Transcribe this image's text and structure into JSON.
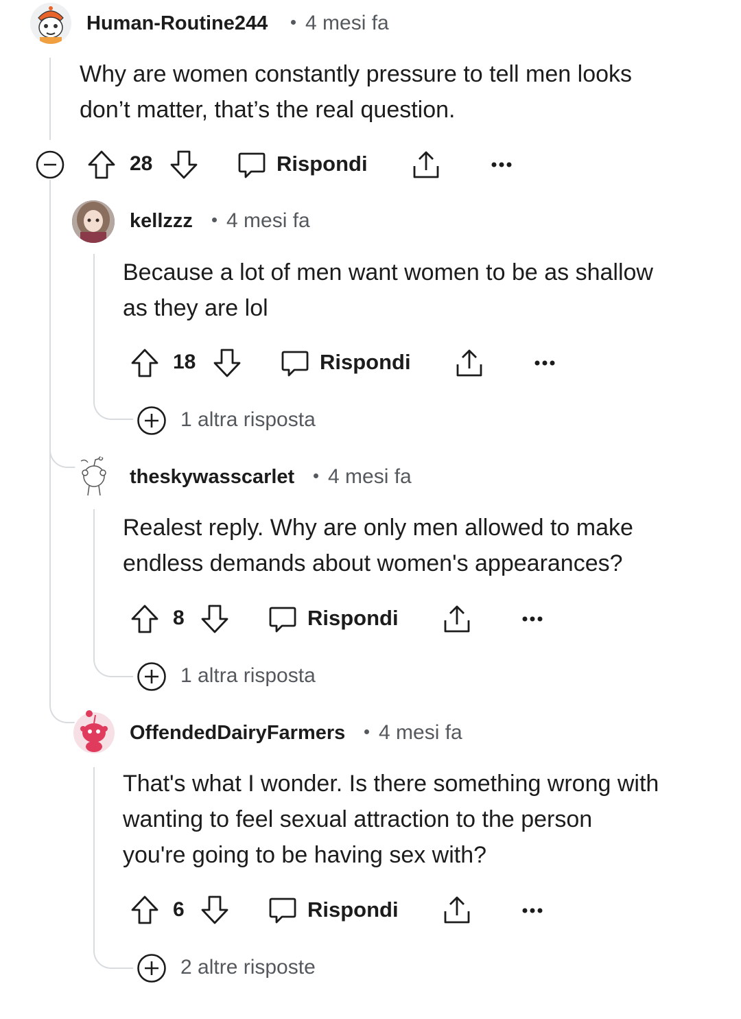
{
  "comments": [
    {
      "username": "Human-Routine244",
      "time": "4 mesi fa",
      "body": [
        "Why are women constantly pressure to tell men looks",
        "don’t matter, that’s the real question."
      ],
      "votes": "28",
      "reply_label": "Rispondi"
    },
    {
      "username": "kellzzz",
      "time": "4 mesi fa",
      "body": [
        "Because a lot of men want women to be as shallow",
        "as they are lol"
      ],
      "votes": "18",
      "reply_label": "Rispondi",
      "more_replies": "1 altra risposta"
    },
    {
      "username": "theskywasscarlet",
      "time": "4 mesi fa",
      "body": [
        "Realest reply. Why are only men allowed to make",
        "endless demands about women's appearances?"
      ],
      "votes": "8",
      "reply_label": "Rispondi",
      "more_replies": "1 altra risposta"
    },
    {
      "username": "OffendedDairyFarmers",
      "time": "4 mesi fa",
      "body": [
        "That's what I wonder. Is there something wrong with",
        "wanting to feel sexual attraction to the person",
        "you're going to be having sex with?"
      ],
      "votes": "6",
      "reply_label": "Rispondi",
      "more_replies": "2 altre risposte"
    }
  ],
  "colors": {
    "text": "#1c1c1c",
    "meta": "#55595d",
    "thread_line": "#d9dcdf",
    "snoo_red": "#e03b5c"
  },
  "icons": [
    "collapse-icon",
    "upvote-icon",
    "downvote-icon",
    "comment-icon",
    "share-icon",
    "more-options-icon",
    "expand-plus-icon"
  ]
}
